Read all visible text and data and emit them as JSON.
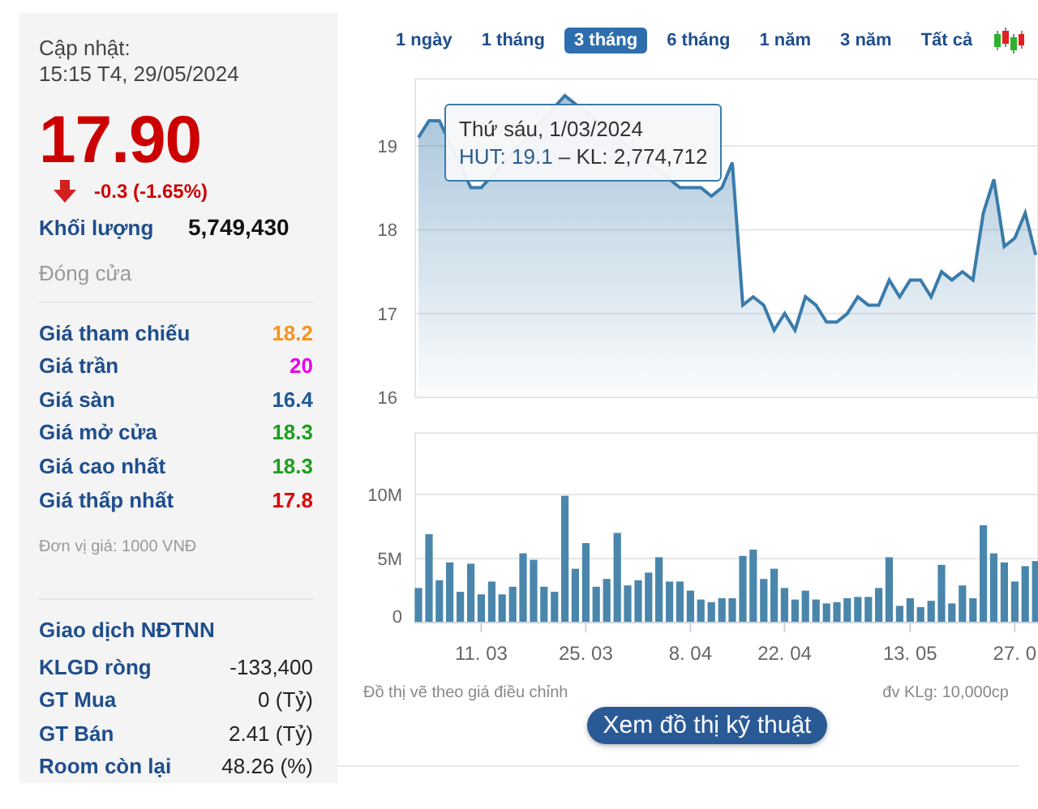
{
  "quote": {
    "updated_label": "Cập nhật:",
    "updated_time": "15:15 T4, 29/05/2024",
    "price": "17.90",
    "change": "-0.3 (-1.65%)",
    "volume_label": "Khối lượng",
    "volume": "5,749,430",
    "session_status": "Đóng cửa"
  },
  "prices": [
    {
      "label": "Giá tham chiếu",
      "value": "18.2",
      "color": "#f7941d"
    },
    {
      "label": "Giá trần",
      "value": "20",
      "color": "#e600e6"
    },
    {
      "label": "Giá sàn",
      "value": "16.4",
      "color": "#1f5a96"
    },
    {
      "label": "Giá mở cửa",
      "value": "18.3",
      "color": "#1e9e1e"
    },
    {
      "label": "Giá cao nhất",
      "value": "18.3",
      "color": "#1e9e1e"
    },
    {
      "label": "Giá thấp nhất",
      "value": "17.8",
      "color": "#e00000"
    }
  ],
  "price_unit": "Đơn vị giá: 1000 VNĐ",
  "foreign": {
    "title": "Giao dịch NĐTNN",
    "rows": [
      {
        "label": "KLGD ròng",
        "value": "-133,400"
      },
      {
        "label": "GT Mua",
        "value": "0 (Tỷ)"
      },
      {
        "label": "GT Bán",
        "value": "2.41 (Tỷ)"
      },
      {
        "label": "Room còn lại",
        "value": "48.26 (%)"
      }
    ]
  },
  "tabs": [
    {
      "label": "1 ngày",
      "selected": false
    },
    {
      "label": "1 tháng",
      "selected": false
    },
    {
      "label": "3 tháng",
      "selected": true
    },
    {
      "label": "6 tháng",
      "selected": false
    },
    {
      "label": "1 năm",
      "selected": false
    },
    {
      "label": "3 năm",
      "selected": false
    },
    {
      "label": "Tất cả",
      "selected": false
    }
  ],
  "price_chart": {
    "chart_data": {
      "type": "area",
      "grid": true,
      "yticks": [
        16,
        17,
        18,
        19
      ],
      "ylim": [
        16,
        19.8
      ],
      "series": [
        {
          "color": "#3a7bab",
          "values": [
            19.1,
            19.3,
            19.3,
            null,
            null,
            18.5,
            18.5,
            null,
            null,
            null,
            null,
            null,
            null,
            null,
            19.6,
            null,
            null,
            null,
            null,
            null,
            null,
            null,
            null,
            null,
            null,
            18.5,
            null,
            18.5,
            18.4,
            18.5,
            18.8,
            17.1,
            17.2,
            17.1,
            16.8,
            17.0,
            16.8,
            17.2,
            17.1,
            16.9,
            16.9,
            17.0,
            17.2,
            17.1,
            17.1,
            17.4,
            17.2,
            17.4,
            17.4,
            17.2,
            17.5,
            17.4,
            17.5,
            17.4,
            18.2,
            18.6,
            17.8,
            17.9,
            18.2,
            17.7
          ]
        }
      ]
    },
    "tooltip": {
      "title": "Thứ sáu, 1/03/2024",
      "price": "HUT: 19.1",
      "volume": " – KL: 2,774,712"
    }
  },
  "volume_chart": {
    "chart_data": {
      "type": "bar",
      "grid": true,
      "ylim": [
        0,
        14.8
      ],
      "yticks": [
        {
          "value": 0,
          "label": "0"
        },
        {
          "value": 5,
          "label": "5M"
        },
        {
          "value": 10,
          "label": "10M"
        }
      ],
      "series": [
        {
          "color": "#4a86ab",
          "values": [
            2.7,
            6.9,
            3.3,
            4.7,
            2.4,
            4.6,
            2.2,
            3.2,
            2.2,
            2.8,
            5.4,
            4.9,
            2.8,
            2.4,
            9.9,
            4.2,
            6.2,
            2.8,
            3.4,
            7.0,
            2.9,
            3.3,
            3.9,
            5.1,
            3.2,
            3.2,
            2.5,
            1.8,
            1.6,
            1.9,
            1.9,
            5.2,
            5.7,
            3.4,
            4.2,
            2.7,
            1.8,
            2.5,
            1.8,
            1.5,
            1.6,
            1.9,
            2.0,
            2.0,
            2.7,
            5.1,
            1.3,
            1.9,
            1.2,
            1.7,
            4.5,
            1.5,
            2.9,
            1.9,
            7.6,
            5.4,
            4.7,
            3.2,
            4.4,
            4.8
          ]
        }
      ]
    },
    "axis_labels": [
      "11. 03",
      "25. 03",
      "8. 04",
      "22. 04",
      "13. 05",
      "27. 0"
    ]
  },
  "footer": {
    "note": "Đồ thị vẽ theo giá điều chỉnh",
    "unit": "đv KLg: 10,000cp",
    "button": "Xem đồ thị kỹ thuật"
  }
}
